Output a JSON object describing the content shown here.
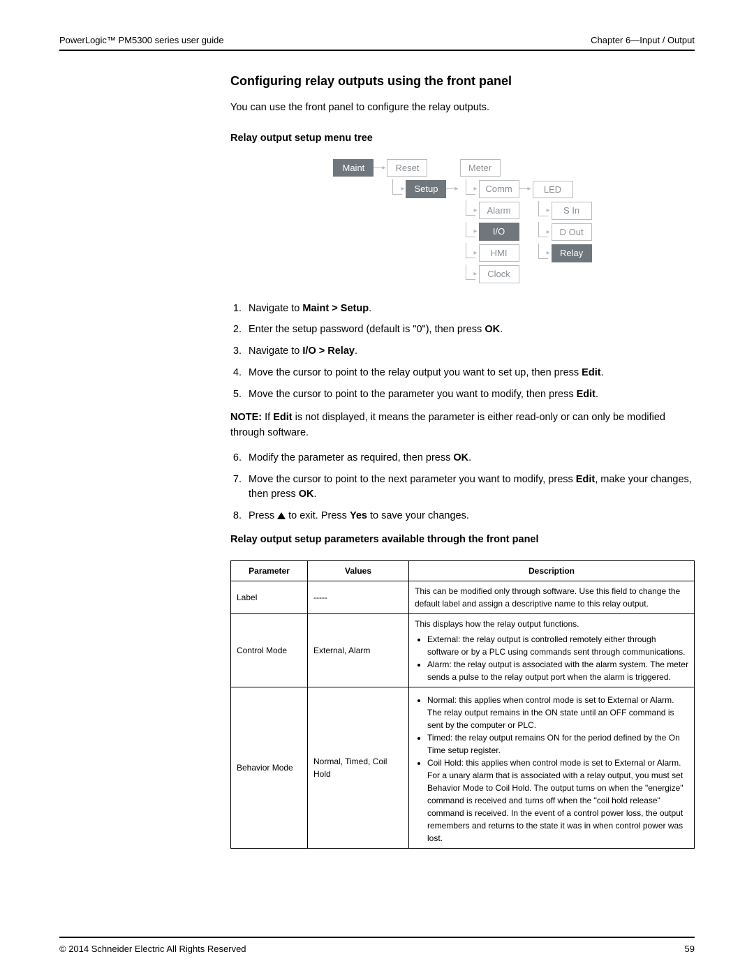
{
  "header": {
    "left": "PowerLogic™ PM5300 series user guide",
    "right": "Chapter 6—Input / Output"
  },
  "title": "Configuring relay outputs using the front panel",
  "intro": "You can use the front panel to configure the relay outputs.",
  "menu_tree_heading": "Relay output setup menu tree",
  "tree": {
    "col1": [
      "Maint"
    ],
    "col2": [
      "Reset",
      "Setup"
    ],
    "col3": [
      "Meter",
      "Comm",
      "Alarm",
      "I/O",
      "HMI",
      "Clock"
    ],
    "col4": [
      "LED",
      "S In",
      "D Out",
      "Relay"
    ]
  },
  "steps": [
    {
      "pre": "Navigate to ",
      "bold": "Maint > Setup",
      "post": "."
    },
    {
      "pre": "Enter the setup password (default is \"0\"), then press ",
      "bold": "OK",
      "post": "."
    },
    {
      "pre": "Navigate to ",
      "bold": "I/O > Relay",
      "post": "."
    },
    {
      "pre": "Move the cursor to point to the relay output you want to set up, then press ",
      "bold": "Edit",
      "post": "."
    },
    {
      "pre": "Move the cursor to point to the parameter you want to modify, then press ",
      "bold": "Edit",
      "post": "."
    }
  ],
  "note": {
    "label": "NOTE:",
    "pre": " If ",
    "bold": "Edit",
    "post": " is not displayed, it means the parameter is either read-only or can only be modified through software."
  },
  "steps2": [
    {
      "pre": "Modify the parameter as required, then press ",
      "bold": "OK",
      "post": "."
    },
    {
      "pre": "Move the cursor to point to the next parameter you want to modify, press ",
      "bold": "Edit",
      "post": ", make your changes, then press ",
      "bold2": "OK",
      "post2": "."
    },
    {
      "pre": "Press ",
      "icon": "up",
      "pre2": " to exit. Press ",
      "bold": "Yes",
      "post": " to save your changes."
    }
  ],
  "table_heading": "Relay output setup parameters available through the front panel",
  "table": {
    "headers": [
      "Parameter",
      "Values",
      "Description"
    ],
    "rows": [
      {
        "param": "Label",
        "values": "-----",
        "desc_plain": "This can be modified only through software. Use this field to change the default label and assign a descriptive name to this relay output."
      },
      {
        "param": "Control Mode",
        "values": "External, Alarm",
        "desc_intro": "This displays how the relay output functions.",
        "desc_list": [
          "External: the relay output is controlled remotely either through software or by a PLC using commands sent through communications.",
          "Alarm: the relay output is associated with the alarm system. The meter sends a pulse to the relay output port when the alarm is triggered."
        ]
      },
      {
        "param": "Behavior Mode",
        "values": "Normal, Timed, Coil Hold",
        "desc_list": [
          "Normal: this applies when control mode is set to External or Alarm. The relay output remains in the ON state until an OFF command is sent by the computer or PLC.",
          "Timed: the relay output remains ON for the period defined by the On Time setup register.",
          "Coil Hold: this applies when control mode is set to External or Alarm. For a unary alarm that is associated with a relay output, you must set Behavior Mode to Coil Hold. The output turns on when the \"energize\" command is received and turns off when the \"coil hold release\" command is received. In the event of a control power loss, the output remembers and returns to the state it was in when control power was lost."
        ]
      }
    ]
  },
  "footer": {
    "left": "© 2014 Schneider Electric All Rights Reserved",
    "right": "59"
  }
}
